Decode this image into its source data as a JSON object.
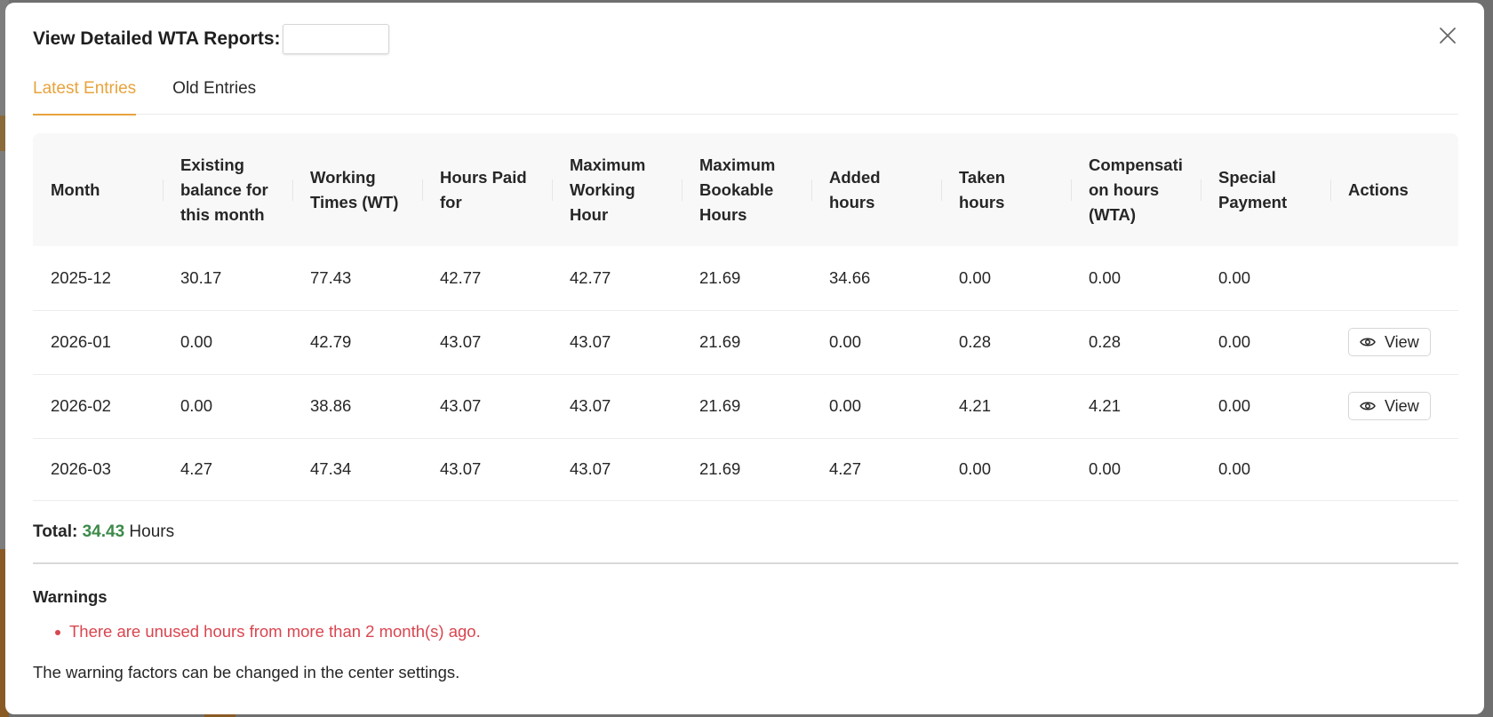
{
  "modal": {
    "title": "View Detailed WTA Reports:",
    "report_select_value": ""
  },
  "tabs": [
    {
      "label": "Latest Entries",
      "active": true
    },
    {
      "label": "Old Entries",
      "active": false
    }
  ],
  "table": {
    "headers": {
      "month": "Month",
      "existing_balance": "Existing balance for this month",
      "working_times": "Working Times (WT)",
      "hours_paid": "Hours Paid for",
      "max_working": "Maximum Working Hour",
      "max_bookable": "Maximum Bookable Hours",
      "added": "Added hours",
      "taken": "Taken hours",
      "compensation": "Compensati on hours (WTA)",
      "special": "Special Payment",
      "actions": "Actions"
    },
    "rows": [
      {
        "month": "2025-12",
        "existing_balance": "30.17",
        "working_times": "77.43",
        "hours_paid": "42.77",
        "max_working": "42.77",
        "max_bookable": "21.69",
        "added": "34.66",
        "taken": "0.00",
        "compensation": "0.00",
        "special": "0.00",
        "action": ""
      },
      {
        "month": "2026-01",
        "existing_balance": "0.00",
        "working_times": "42.79",
        "hours_paid": "43.07",
        "max_working": "43.07",
        "max_bookable": "21.69",
        "added": "0.00",
        "taken": "0.28",
        "compensation": "0.28",
        "special": "0.00",
        "action": "View"
      },
      {
        "month": "2026-02",
        "existing_balance": "0.00",
        "working_times": "38.86",
        "hours_paid": "43.07",
        "max_working": "43.07",
        "max_bookable": "21.69",
        "added": "0.00",
        "taken": "4.21",
        "compensation": "4.21",
        "special": "0.00",
        "action": "View"
      },
      {
        "month": "2026-03",
        "existing_balance": "4.27",
        "working_times": "47.34",
        "hours_paid": "43.07",
        "max_working": "43.07",
        "max_bookable": "21.69",
        "added": "4.27",
        "taken": "0.00",
        "compensation": "0.00",
        "special": "0.00",
        "action": ""
      }
    ]
  },
  "total": {
    "label": "Total:",
    "value": "34.43",
    "unit": "Hours"
  },
  "warnings": {
    "title": "Warnings",
    "items": [
      "There are unused hours from more than 2 month(s) ago."
    ],
    "note": "The warning factors can be changed in the center settings."
  },
  "colors": {
    "accent": "#e8a33d",
    "total_value": "#3c8a4a",
    "warning": "#d9454f"
  },
  "icons": {
    "close": "close-icon",
    "view": "eye-icon"
  }
}
